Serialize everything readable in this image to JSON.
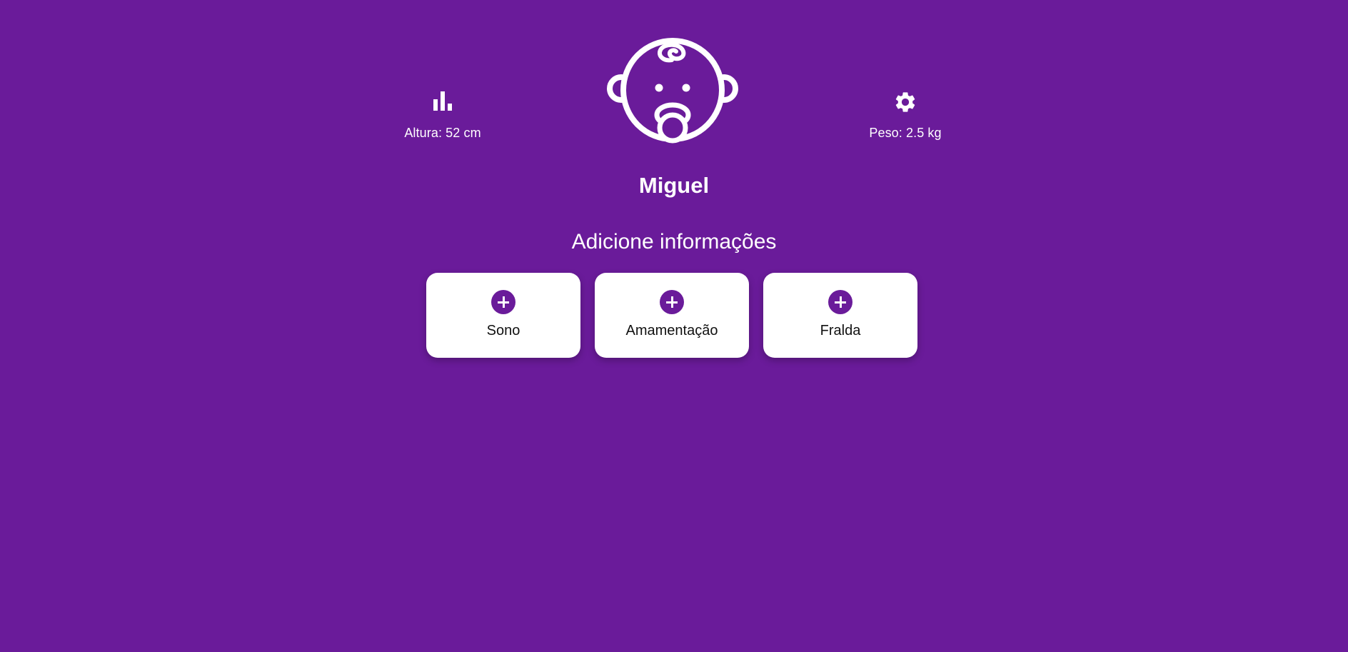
{
  "header": {
    "height": {
      "icon": "bar-chart-icon",
      "label": "Altura: 52 cm"
    },
    "weight": {
      "icon": "gear-icon",
      "label": "Peso: 2.5 kg"
    },
    "avatar_icon": "baby-face-icon",
    "baby_name": "Miguel"
  },
  "section": {
    "title": "Adicione informações",
    "cards": [
      {
        "icon": "plus-circle-icon",
        "label": "Sono"
      },
      {
        "icon": "plus-circle-icon",
        "label": "Amamentação"
      },
      {
        "icon": "plus-circle-icon",
        "label": "Fralda"
      }
    ]
  },
  "colors": {
    "background": "#6a1b9a",
    "card": "#ffffff",
    "accent": "#6a1b9a"
  }
}
